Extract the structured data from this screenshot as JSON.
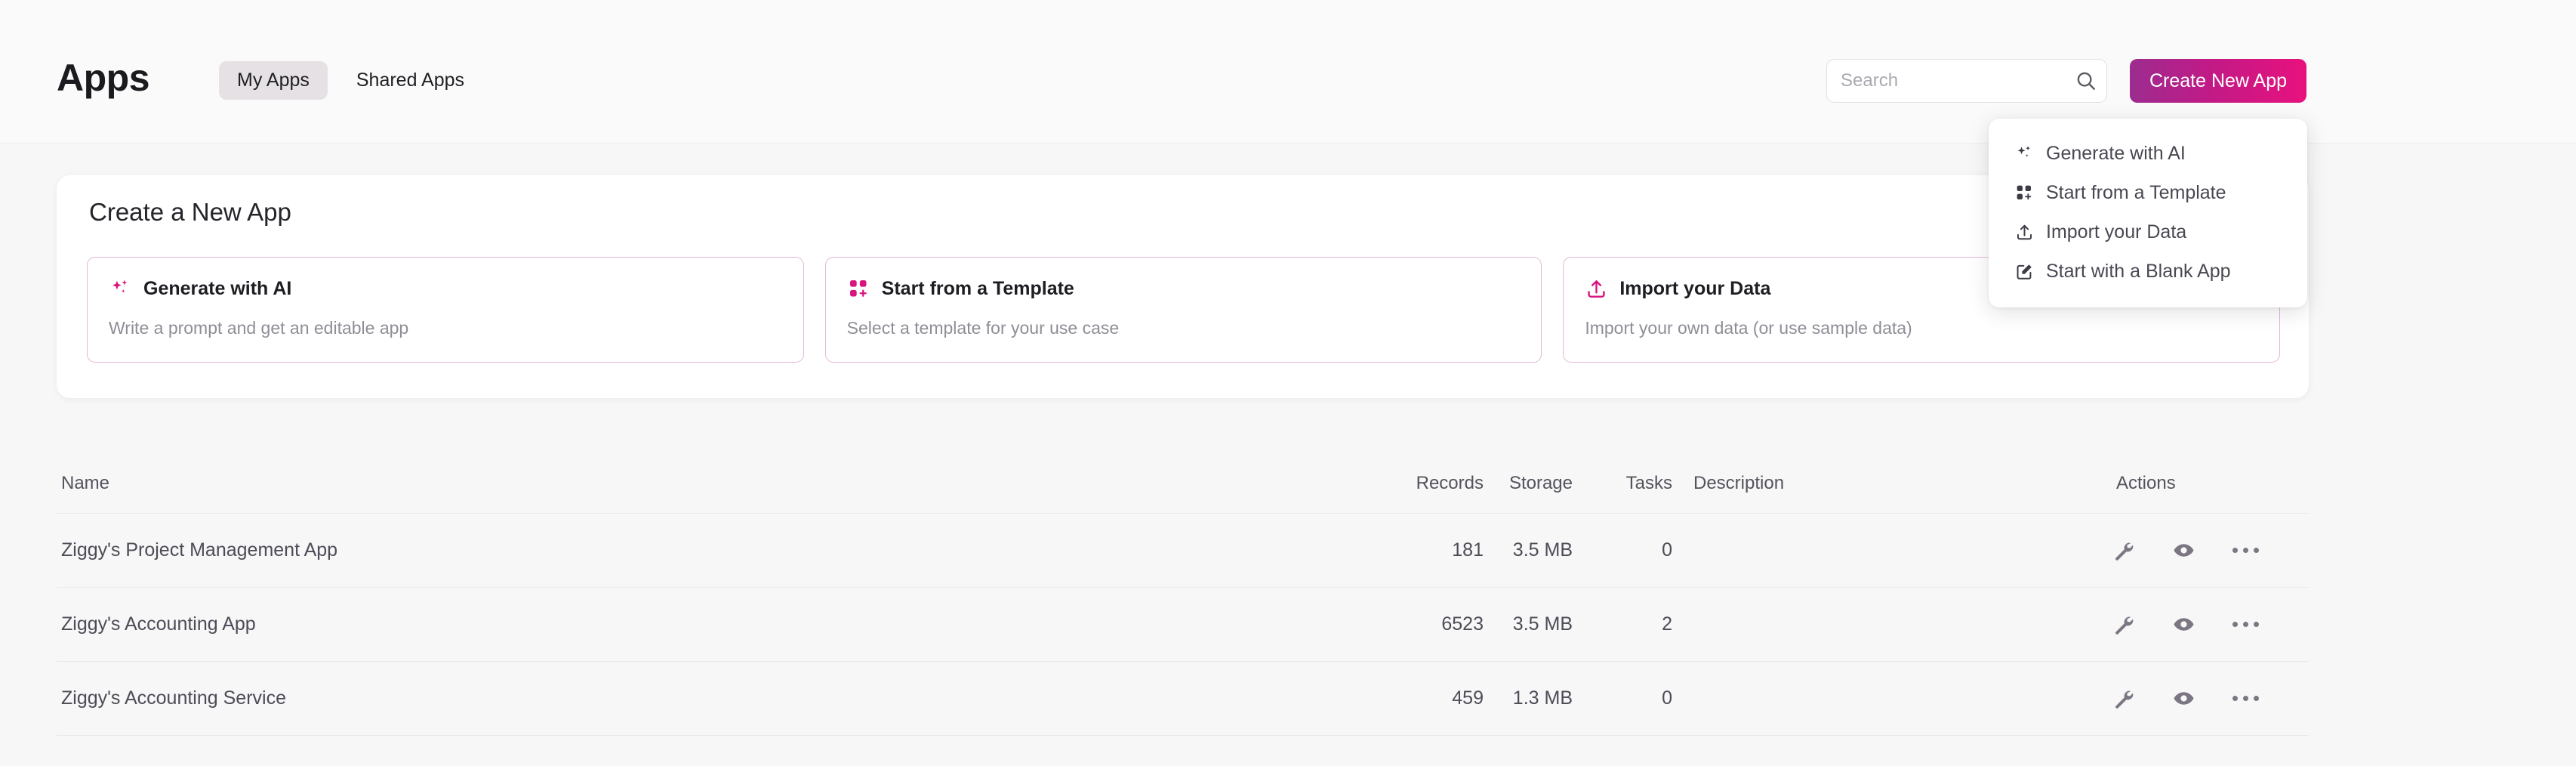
{
  "header": {
    "title": "Apps",
    "tabs": [
      {
        "label": "My Apps",
        "active": true
      },
      {
        "label": "Shared Apps",
        "active": false
      }
    ],
    "search": {
      "placeholder": "Search",
      "value": "",
      "icon": "search-icon"
    },
    "create_button": {
      "label": "Create New App",
      "gradient_from": "#9c2c8f",
      "gradient_to": "#e8117e"
    }
  },
  "dropdown": {
    "items": [
      {
        "label": "Generate with AI",
        "icon": "sparkles-icon"
      },
      {
        "label": "Start from a Template",
        "icon": "template-grid-icon"
      },
      {
        "label": "Import your Data",
        "icon": "upload-icon"
      },
      {
        "label": "Start with a Blank App",
        "icon": "pencil-square-icon"
      }
    ]
  },
  "panel": {
    "title": "Create a New App",
    "cards": [
      {
        "title": "Generate with AI",
        "subtitle": "Write a prompt and get an editable app",
        "icon": "sparkles-icon"
      },
      {
        "title": "Start from a Template",
        "subtitle": "Select a template for your use case",
        "icon": "template-grid-icon"
      },
      {
        "title": "Import your Data",
        "subtitle": "Import your own data (or use sample data)",
        "icon": "upload-icon"
      }
    ],
    "accent_border": "#e2b7d8",
    "accent_icon": "#d8157f"
  },
  "table": {
    "columns": {
      "name": "Name",
      "records": "Records",
      "storage": "Storage",
      "tasks": "Tasks",
      "description": "Description",
      "actions": "Actions"
    },
    "rows": [
      {
        "name": "Ziggy's Project Management App",
        "records": "181",
        "storage": "3.5 MB",
        "tasks": "0",
        "description": "",
        "actions": [
          "wrench-icon",
          "eye-icon",
          "more-options-icon"
        ]
      },
      {
        "name": "Ziggy's Accounting App",
        "records": "6523",
        "storage": "3.5 MB",
        "tasks": "2",
        "description": "",
        "actions": [
          "wrench-icon",
          "eye-icon",
          "more-options-icon"
        ]
      },
      {
        "name": "Ziggy's Accounting Service",
        "records": "459",
        "storage": "1.3 MB",
        "tasks": "0",
        "description": "",
        "actions": [
          "wrench-icon",
          "eye-icon",
          "more-options-icon"
        ]
      }
    ]
  }
}
